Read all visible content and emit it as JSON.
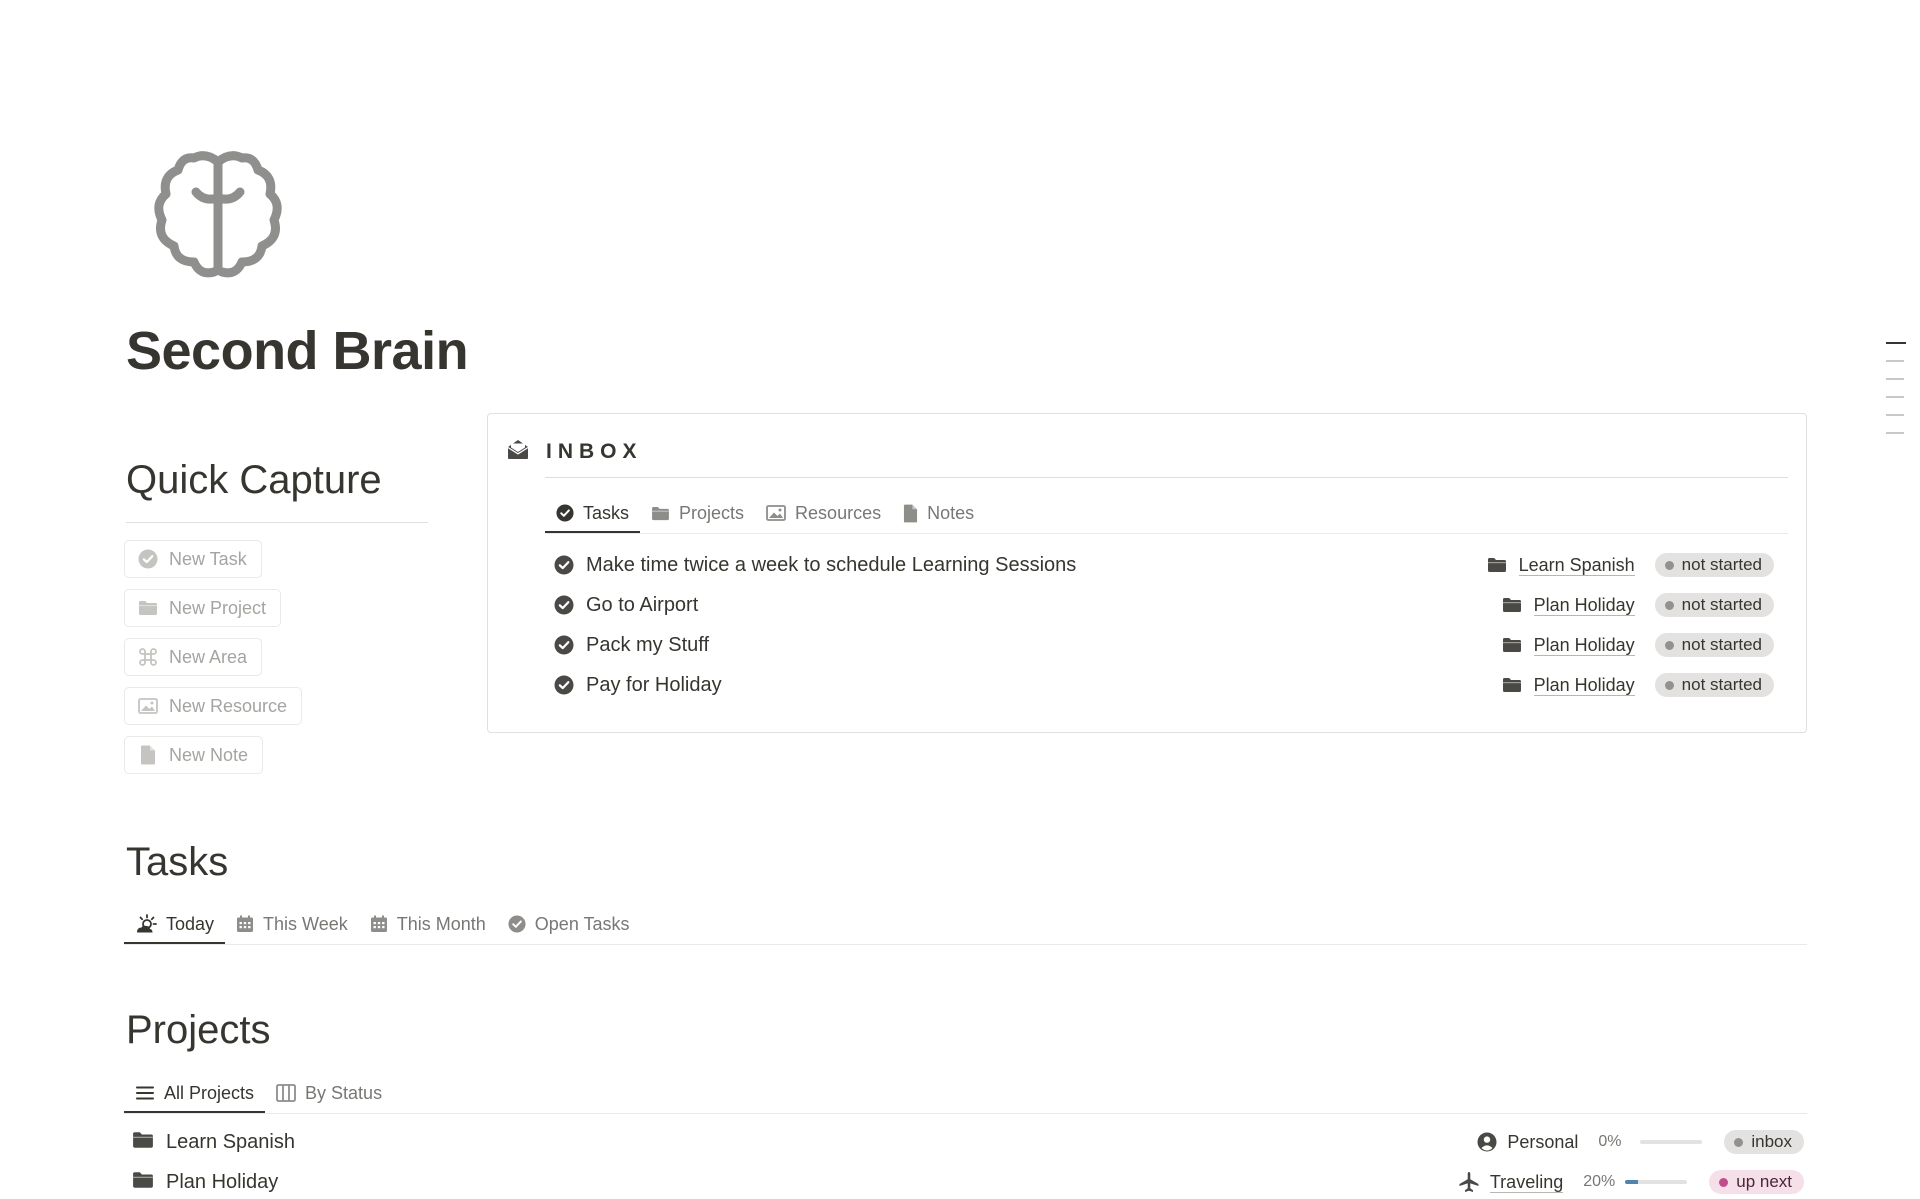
{
  "page": {
    "title": "Second Brain",
    "icon": "brain-icon"
  },
  "quick_capture": {
    "heading": "Quick Capture",
    "buttons": [
      {
        "label": "New Task",
        "icon": "check-circle-icon"
      },
      {
        "label": "New Project",
        "icon": "folder-icon"
      },
      {
        "label": "New Area",
        "icon": "command-icon"
      },
      {
        "label": "New Resource",
        "icon": "image-icon"
      },
      {
        "label": "New Note",
        "icon": "document-icon"
      }
    ]
  },
  "inbox": {
    "title": "INBOX",
    "icon": "open-envelope-icon",
    "tabs": [
      {
        "label": "Tasks",
        "icon": "check-circle-icon",
        "active": true
      },
      {
        "label": "Projects",
        "icon": "folder-icon"
      },
      {
        "label": "Resources",
        "icon": "image-icon"
      },
      {
        "label": "Notes",
        "icon": "document-icon"
      }
    ],
    "tasks": [
      {
        "name": "Make time twice a week to schedule Learning Sessions",
        "project": "Learn Spanish",
        "status": "not started"
      },
      {
        "name": "Go to Airport",
        "project": "Plan Holiday",
        "status": "not started"
      },
      {
        "name": "Pack my Stuff",
        "project": "Plan Holiday",
        "status": "not started"
      },
      {
        "name": "Pay for Holiday",
        "project": "Plan Holiday",
        "status": "not started"
      }
    ]
  },
  "tasks_section": {
    "heading": "Tasks",
    "tabs": [
      {
        "label": "Today",
        "icon": "sun-cloud-icon",
        "active": true
      },
      {
        "label": "This Week",
        "icon": "calendar-icon"
      },
      {
        "label": "This Month",
        "icon": "calendar-icon"
      },
      {
        "label": "Open Tasks",
        "icon": "check-circle-icon"
      }
    ]
  },
  "projects_section": {
    "heading": "Projects",
    "tabs": [
      {
        "label": "All Projects",
        "icon": "list-icon",
        "active": true
      },
      {
        "label": "By Status",
        "icon": "board-icon"
      }
    ],
    "rows": [
      {
        "name": "Learn Spanish",
        "area": "Personal",
        "area_icon": "user-circle-icon",
        "progress": "0%",
        "progress_value": 0,
        "status": "inbox",
        "status_color": "#91918e"
      },
      {
        "name": "Plan Holiday",
        "area": "Traveling",
        "area_icon": "airplane-icon",
        "progress": "20%",
        "progress_value": 0.2,
        "status": "up next",
        "status_color": "#c14c8a"
      }
    ]
  },
  "colors": {
    "text": "#37352f",
    "muted": "#787774",
    "border": "#e1e0dc",
    "progress": "#4d84b0"
  }
}
